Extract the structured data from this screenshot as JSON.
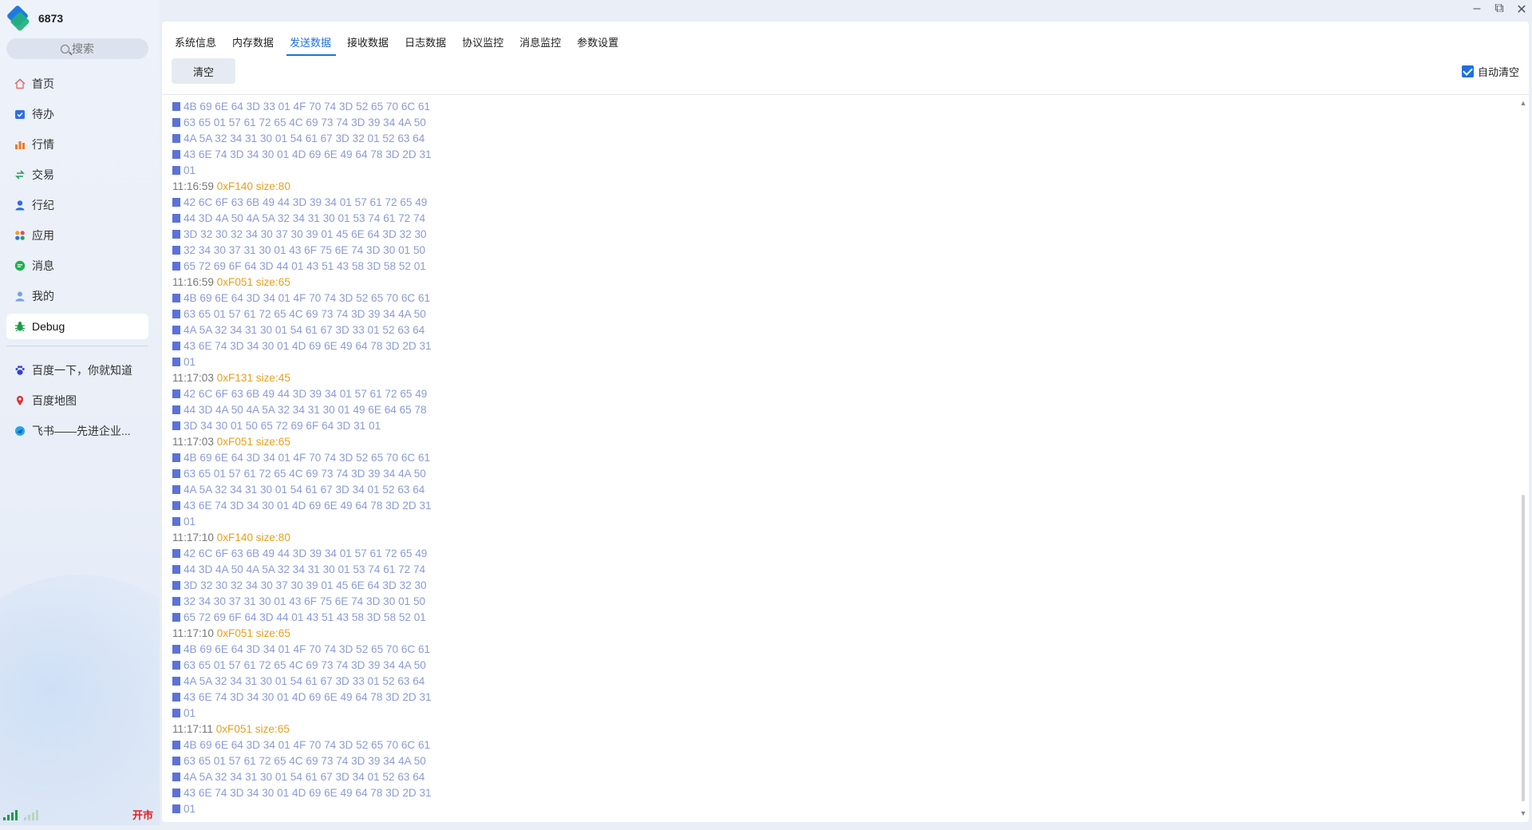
{
  "app": {
    "title": "6873"
  },
  "search": {
    "label": "搜索"
  },
  "nav": [
    {
      "label": "首页",
      "icon": "home-icon"
    },
    {
      "label": "待办",
      "icon": "todo-icon"
    },
    {
      "label": "行情",
      "icon": "market-icon"
    },
    {
      "label": "交易",
      "icon": "trade-icon"
    },
    {
      "label": "行纪",
      "icon": "person-icon"
    },
    {
      "label": "应用",
      "icon": "apps-icon"
    },
    {
      "label": "消息",
      "icon": "message-icon"
    },
    {
      "label": "我的",
      "icon": "user-icon"
    },
    {
      "label": "Debug",
      "icon": "bug-icon",
      "active": true
    }
  ],
  "shortcuts": [
    {
      "label": "百度一下，你就知道",
      "icon": "baidu-icon"
    },
    {
      "label": "百度地图",
      "icon": "map-pin-icon"
    },
    {
      "label": "飞书——先进企业...",
      "icon": "feishu-icon"
    }
  ],
  "status": {
    "market": "开市"
  },
  "tabs": [
    {
      "label": "系统信息"
    },
    {
      "label": "内存数据"
    },
    {
      "label": "发送数据",
      "active": true
    },
    {
      "label": "接收数据"
    },
    {
      "label": "日志数据"
    },
    {
      "label": "协议监控"
    },
    {
      "label": "消息监控"
    },
    {
      "label": "参数设置"
    }
  ],
  "toolbar": {
    "clear_label": "清空",
    "auto_clear_label": "自动清空",
    "auto_clear_checked": true
  },
  "colors": {
    "accent": "#1f6fe0",
    "hex": "#8b9bd6",
    "marker": "#5b72d8",
    "info": "#e6a020"
  },
  "log": [
    {
      "type": "hex",
      "text": "4B 69 6E 64 3D 33 01 4F 70 74 3D 52 65 70 6C 61"
    },
    {
      "type": "hex",
      "text": "63 65 01 57 61 72 65 4C 69 73 74 3D 39 34 4A 50"
    },
    {
      "type": "hex",
      "text": "4A 5A 32 34 31 30 01 54 61 67 3D 32 01 52 63 64"
    },
    {
      "type": "hex",
      "text": "43 6E 74 3D 34 30 01 4D 69 6E 49 64 78 3D 2D 31"
    },
    {
      "type": "hex",
      "text": "01"
    },
    {
      "type": "head",
      "time": "11:16:59",
      "info": "0xF140 size:80"
    },
    {
      "type": "hex",
      "text": "42 6C 6F 63 6B 49 44 3D 39 34 01 57 61 72 65 49"
    },
    {
      "type": "hex",
      "text": "44 3D 4A 50 4A 5A 32 34 31 30 01 53 74 61 72 74"
    },
    {
      "type": "hex",
      "text": "3D 32 30 32 34 30 37 30 39 01 45 6E 64 3D 32 30"
    },
    {
      "type": "hex",
      "text": "32 34 30 37 31 30 01 43 6F 75 6E 74 3D 30 01 50"
    },
    {
      "type": "hex",
      "text": "65 72 69 6F 64 3D 44 01 43 51 43 58 3D 58 52 01"
    },
    {
      "type": "head",
      "time": "11:16:59",
      "info": "0xF051 size:65"
    },
    {
      "type": "hex",
      "text": "4B 69 6E 64 3D 34 01 4F 70 74 3D 52 65 70 6C 61"
    },
    {
      "type": "hex",
      "text": "63 65 01 57 61 72 65 4C 69 73 74 3D 39 34 4A 50"
    },
    {
      "type": "hex",
      "text": "4A 5A 32 34 31 30 01 54 61 67 3D 33 01 52 63 64"
    },
    {
      "type": "hex",
      "text": "43 6E 74 3D 34 30 01 4D 69 6E 49 64 78 3D 2D 31"
    },
    {
      "type": "hex",
      "text": "01"
    },
    {
      "type": "head",
      "time": "11:17:03",
      "info": "0xF131 size:45"
    },
    {
      "type": "hex",
      "text": "42 6C 6F 63 6B 49 44 3D 39 34 01 57 61 72 65 49"
    },
    {
      "type": "hex",
      "text": "44 3D 4A 50 4A 5A 32 34 31 30 01 49 6E 64 65 78"
    },
    {
      "type": "hex",
      "text": "3D 34 30 01 50 65 72 69 6F 64 3D 31 01"
    },
    {
      "type": "head",
      "time": "11:17:03",
      "info": "0xF051 size:65"
    },
    {
      "type": "hex",
      "text": "4B 69 6E 64 3D 34 01 4F 70 74 3D 52 65 70 6C 61"
    },
    {
      "type": "hex",
      "text": "63 65 01 57 61 72 65 4C 69 73 74 3D 39 34 4A 50"
    },
    {
      "type": "hex",
      "text": "4A 5A 32 34 31 30 01 54 61 67 3D 34 01 52 63 64"
    },
    {
      "type": "hex",
      "text": "43 6E 74 3D 34 30 01 4D 69 6E 49 64 78 3D 2D 31"
    },
    {
      "type": "hex",
      "text": "01"
    },
    {
      "type": "head",
      "time": "11:17:10",
      "info": "0xF140 size:80"
    },
    {
      "type": "hex",
      "text": "42 6C 6F 63 6B 49 44 3D 39 34 01 57 61 72 65 49"
    },
    {
      "type": "hex",
      "text": "44 3D 4A 50 4A 5A 32 34 31 30 01 53 74 61 72 74"
    },
    {
      "type": "hex",
      "text": "3D 32 30 32 34 30 37 30 39 01 45 6E 64 3D 32 30"
    },
    {
      "type": "hex",
      "text": "32 34 30 37 31 30 01 43 6F 75 6E 74 3D 30 01 50"
    },
    {
      "type": "hex",
      "text": "65 72 69 6F 64 3D 44 01 43 51 43 58 3D 58 52 01"
    },
    {
      "type": "head",
      "time": "11:17:10",
      "info": "0xF051 size:65"
    },
    {
      "type": "hex",
      "text": "4B 69 6E 64 3D 34 01 4F 70 74 3D 52 65 70 6C 61"
    },
    {
      "type": "hex",
      "text": "63 65 01 57 61 72 65 4C 69 73 74 3D 39 34 4A 50"
    },
    {
      "type": "hex",
      "text": "4A 5A 32 34 31 30 01 54 61 67 3D 33 01 52 63 64"
    },
    {
      "type": "hex",
      "text": "43 6E 74 3D 34 30 01 4D 69 6E 49 64 78 3D 2D 31"
    },
    {
      "type": "hex",
      "text": "01"
    },
    {
      "type": "head",
      "time": "11:17:11",
      "info": "0xF051 size:65"
    },
    {
      "type": "hex",
      "text": "4B 69 6E 64 3D 34 01 4F 70 74 3D 52 65 70 6C 61"
    },
    {
      "type": "hex",
      "text": "63 65 01 57 61 72 65 4C 69 73 74 3D 39 34 4A 50"
    },
    {
      "type": "hex",
      "text": "4A 5A 32 34 31 30 01 54 61 67 3D 34 01 52 63 64"
    },
    {
      "type": "hex",
      "text": "43 6E 74 3D 34 30 01 4D 69 6E 49 64 78 3D 2D 31"
    },
    {
      "type": "hex",
      "text": "01"
    }
  ]
}
